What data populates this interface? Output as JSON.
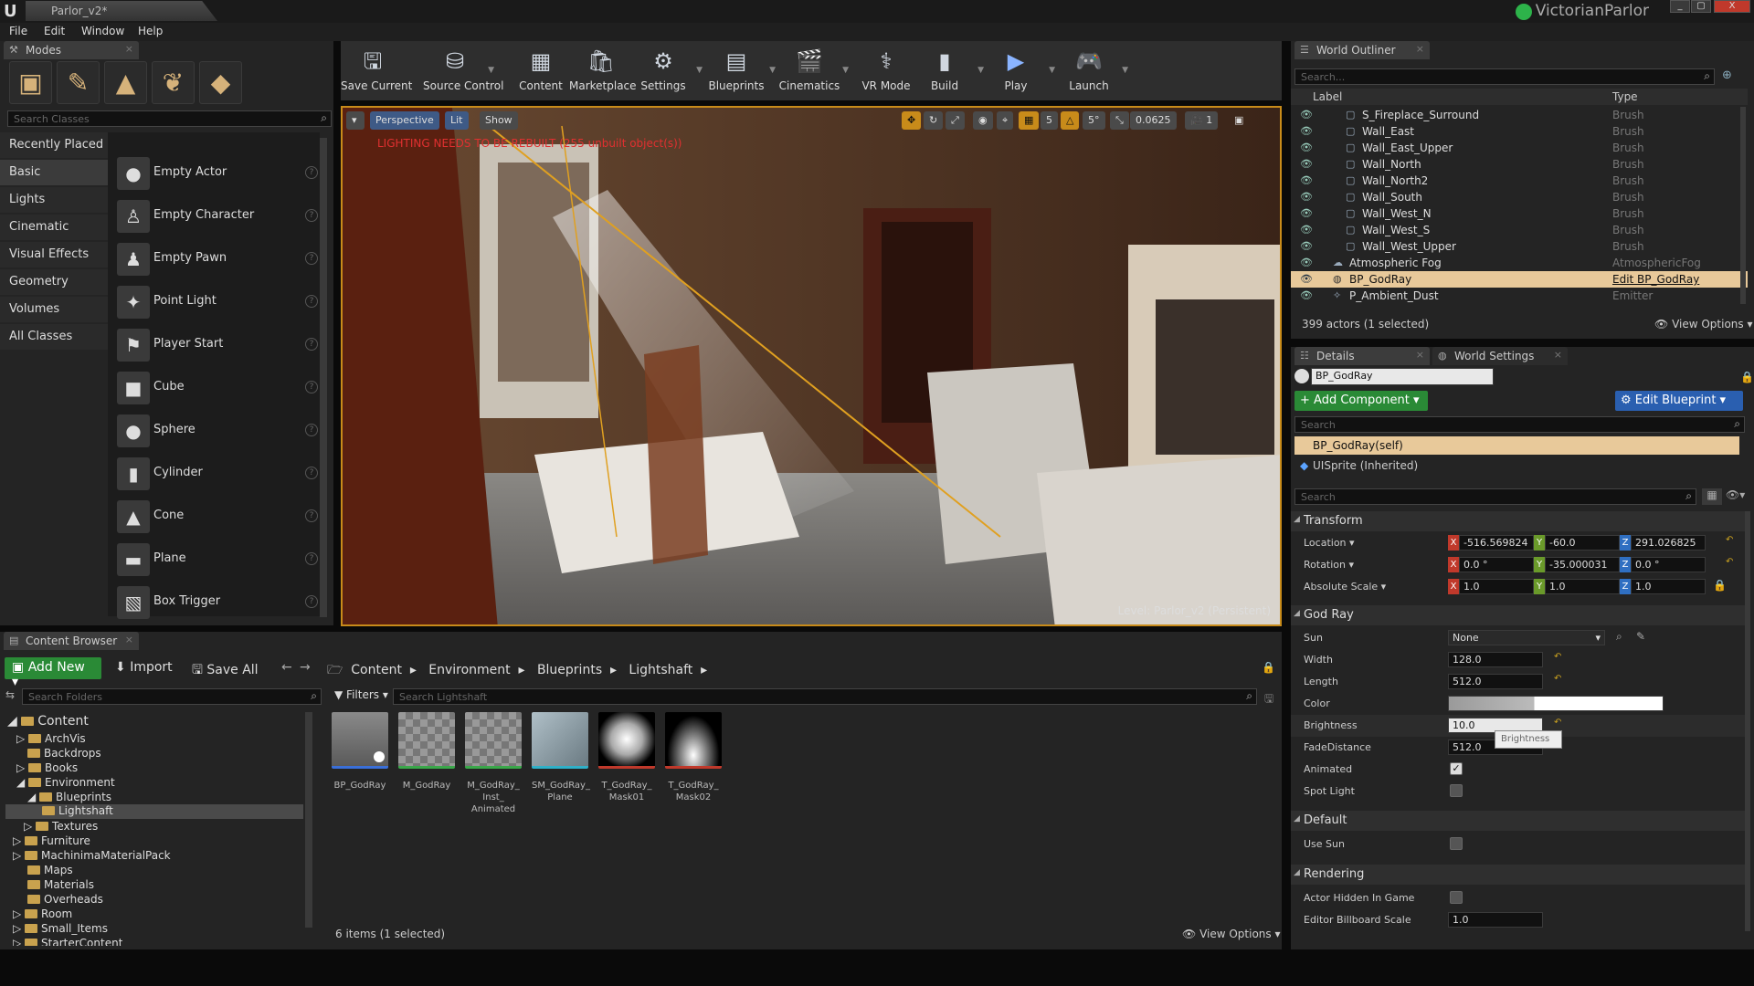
{
  "app": {
    "tab_title": "Parlor_v2*",
    "project_name": "VictorianParlor",
    "window_controls": [
      "_",
      "▢",
      "X"
    ]
  },
  "menu": [
    "File",
    "Edit",
    "Window",
    "Help"
  ],
  "modes": {
    "tab_label": "Modes",
    "search_placeholder": "Search Classes",
    "categories": [
      "Recently Placed",
      "Basic",
      "Lights",
      "Cinematic",
      "Visual Effects",
      "Geometry",
      "Volumes",
      "All Classes"
    ],
    "selected_category": "Basic",
    "items": [
      "Empty Actor",
      "Empty Character",
      "Empty Pawn",
      "Point Light",
      "Player Start",
      "Cube",
      "Sphere",
      "Cylinder",
      "Cone",
      "Plane",
      "Box Trigger"
    ]
  },
  "toolbar": {
    "buttons": [
      {
        "label": "Save Current",
        "icon": "save-icon"
      },
      {
        "label": "Source Control",
        "icon": "source-control-icon"
      },
      {
        "label": "Content",
        "icon": "content-icon"
      },
      {
        "label": "Marketplace",
        "icon": "marketplace-icon"
      },
      {
        "label": "Settings",
        "icon": "settings-icon"
      },
      {
        "label": "Blueprints",
        "icon": "blueprints-icon"
      },
      {
        "label": "Cinematics",
        "icon": "cinematics-icon"
      },
      {
        "label": "VR Mode",
        "icon": "vr-icon"
      },
      {
        "label": "Build",
        "icon": "build-icon"
      },
      {
        "label": "Play",
        "icon": "play-icon"
      },
      {
        "label": "Launch",
        "icon": "launch-icon"
      }
    ]
  },
  "viewport": {
    "view_mode": "Perspective",
    "lighting": "Lit",
    "show": "Show",
    "rebuild_warning": "LIGHTING NEEDS TO BE REBUILT (255 unbuilt object(s))",
    "level_label": "Level:  Parlor_v2 (Persistent)",
    "grid_snap": "5",
    "rotation_snap": "5°",
    "scale_snap": "0.0625",
    "camera_speed": "1"
  },
  "outliner": {
    "tab_label": "World Outliner",
    "search_placeholder": "Search...",
    "col_label": "Label",
    "col_type": "Type",
    "rows": [
      {
        "label": "S_Fireplace_Surround",
        "type": "Brush",
        "indent": 1
      },
      {
        "label": "Wall_East",
        "type": "Brush",
        "indent": 1
      },
      {
        "label": "Wall_East_Upper",
        "type": "Brush",
        "indent": 1
      },
      {
        "label": "Wall_North",
        "type": "Brush",
        "indent": 1
      },
      {
        "label": "Wall_North2",
        "type": "Brush",
        "indent": 1
      },
      {
        "label": "Wall_South",
        "type": "Brush",
        "indent": 1
      },
      {
        "label": "Wall_West_N",
        "type": "Brush",
        "indent": 1
      },
      {
        "label": "Wall_West_S",
        "type": "Brush",
        "indent": 1
      },
      {
        "label": "Wall_West_Upper",
        "type": "Brush",
        "indent": 1
      },
      {
        "label": "Atmospheric Fog",
        "type": "AtmosphericFog",
        "indent": 0
      },
      {
        "label": "BP_GodRay",
        "type": "Edit BP_GodRay",
        "indent": 0,
        "selected": true
      },
      {
        "label": "P_Ambient_Dust",
        "type": "Emitter",
        "indent": 0
      }
    ],
    "status": "399 actors (1 selected)",
    "view_options": "View Options"
  },
  "details": {
    "tab_label": "Details",
    "tab2_label": "World Settings",
    "actor_name": "BP_GodRay",
    "add_component": "+ Add Component",
    "edit_blueprint": "Edit Blueprint",
    "search_placeholder": "Search",
    "self_component": "BP_GodRay(self)",
    "inherited_component": "UISprite (Inherited)",
    "transform": {
      "title": "Transform",
      "location_label": "Location",
      "location": [
        "-516.569824",
        "-60.0",
        "291.026825"
      ],
      "rotation_label": "Rotation",
      "rotation": [
        "0.0 °",
        "-35.000031",
        "0.0 °"
      ],
      "scale_label": "Absolute Scale",
      "scale": [
        "1.0",
        "1.0",
        "1.0"
      ]
    },
    "god_ray": {
      "title": "God Ray",
      "sun_label": "Sun",
      "sun": "None",
      "width_label": "Width",
      "width": "128.0",
      "length_label": "Length",
      "length": "512.0",
      "color_label": "Color",
      "brightness_label": "Brightness",
      "brightness": "10.0",
      "brightness_tooltip": "Brightness",
      "fade_label": "FadeDistance",
      "fade": "512.0",
      "animated_label": "Animated",
      "animated": true,
      "spot_label": "Spot Light",
      "spot": false
    },
    "default": {
      "title": "Default",
      "use_sun_label": "Use Sun",
      "use_sun": false
    },
    "rendering": {
      "title": "Rendering",
      "hidden_label": "Actor Hidden In Game",
      "hidden": false,
      "billboard_label": "Editor Billboard Scale",
      "billboard": "1.0"
    }
  },
  "content_browser": {
    "tab_label": "Content Browser",
    "add_new": "Add New",
    "import": "Import",
    "save_all": "Save All",
    "breadcrumb": [
      "Content",
      "Environment",
      "Blueprints",
      "Lightshaft"
    ],
    "search_folders": "Search Folders",
    "filters": "Filters",
    "search_assets": "Search Lightshaft",
    "folders": [
      {
        "name": "Content",
        "depth": 0
      },
      {
        "name": "ArchVis",
        "depth": 1
      },
      {
        "name": "Backdrops",
        "depth": 1
      },
      {
        "name": "Books",
        "depth": 1
      },
      {
        "name": "Environment",
        "depth": 1
      },
      {
        "name": "Blueprints",
        "depth": 2
      },
      {
        "name": "Lightshaft",
        "depth": 3,
        "selected": true
      },
      {
        "name": "Textures",
        "depth": 2
      },
      {
        "name": "Furniture",
        "depth": 1
      },
      {
        "name": "MachinimaMaterialPack",
        "depth": 1
      },
      {
        "name": "Maps",
        "depth": 1
      },
      {
        "name": "Materials",
        "depth": 1
      },
      {
        "name": "Overheads",
        "depth": 1
      },
      {
        "name": "Room",
        "depth": 1
      },
      {
        "name": "Small_Items",
        "depth": 1
      },
      {
        "name": "StarterContent",
        "depth": 1
      }
    ],
    "assets": [
      {
        "label": "BP_GodRay",
        "bar": "#3a6fd8"
      },
      {
        "label": "M_GodRay",
        "bar": "#3aa84a"
      },
      {
        "label": "M_GodRay_ Inst_ Animated",
        "bar": "#3aa84a"
      },
      {
        "label": "SM_GodRay_ Plane",
        "bar": "#2fb0c8"
      },
      {
        "label": "T_GodRay_ Mask01",
        "bar": "#c0392b"
      },
      {
        "label": "T_GodRay_ Mask02",
        "bar": "#c0392b"
      }
    ],
    "status": "6 items (1 selected)",
    "view_options": "View Options"
  }
}
